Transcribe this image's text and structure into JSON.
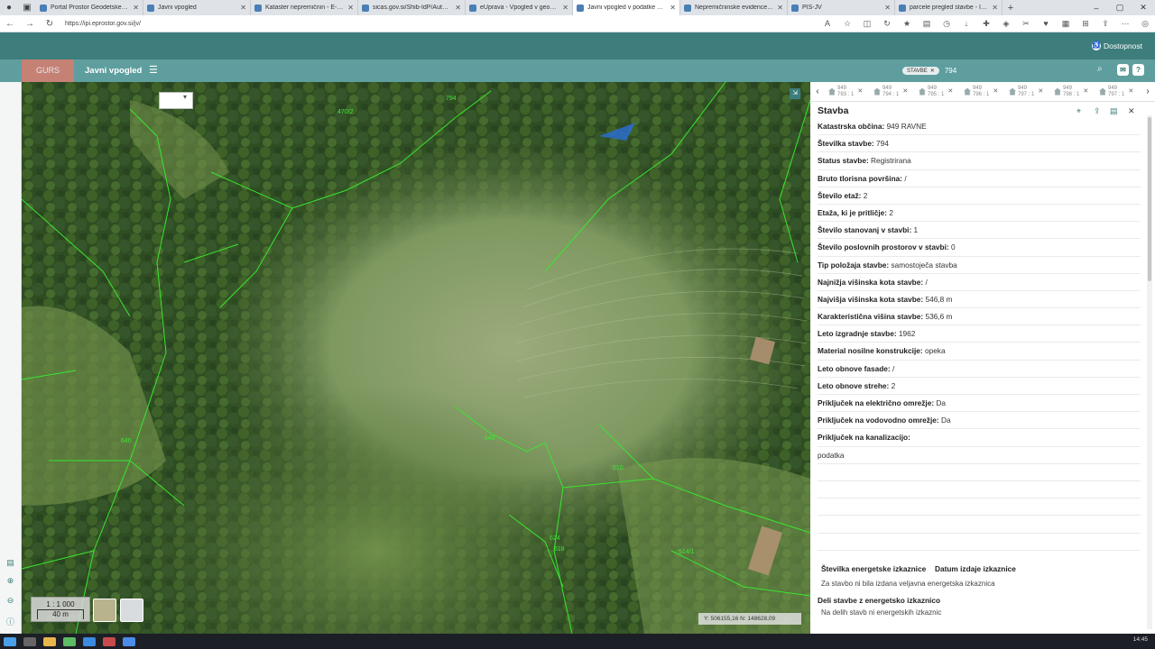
{
  "browser": {
    "tabs": [
      {
        "title": "Portal Prostor Geodetske uprave",
        "active": false
      },
      {
        "title": "Javni vpogled",
        "active": false
      },
      {
        "title": "Kataster nepremičnin - E-prostor",
        "active": false
      },
      {
        "title": "sicas.gov.si/Shib-IdP/Authn/SICAS",
        "active": false
      },
      {
        "title": "eUprava - Vpogled v geodetske p",
        "active": false
      },
      {
        "title": "Javni vpogled v podatke o nepre",
        "active": true
      },
      {
        "title": "Nepremičninske evidence | GOV.SI",
        "active": false
      },
      {
        "title": "PIS-JV",
        "active": false
      },
      {
        "title": "parcele pregled stavbe - Iskanje",
        "active": false
      }
    ],
    "url": "https://ipi.eprostor.gov.si/jv/"
  },
  "app": {
    "accessibility": "Dostopnost",
    "title": "Javni vpogled",
    "search_chip": "STAVBE",
    "search_value": "794"
  },
  "map": {
    "scale_ratio": "1 : 1 000",
    "scale_bar": "40 m",
    "coords": "Y: 506155,16  N: 148628,09",
    "parcel_labels": [
      "470/2",
      "794",
      "640",
      "646",
      "610",
      "514/1",
      "618",
      "624"
    ]
  },
  "panel": {
    "title": "Stavba",
    "building_tabs": [
      {
        "top": "949",
        "bottom": "793 : 1"
      },
      {
        "top": "949",
        "bottom": "794 : 1"
      },
      {
        "top": "949",
        "bottom": "795 : 1"
      },
      {
        "top": "949",
        "bottom": "796 : 1"
      },
      {
        "top": "949",
        "bottom": "797 : 1"
      },
      {
        "top": "949",
        "bottom": "798 : 1"
      },
      {
        "top": "949",
        "bottom": "797 : 1"
      }
    ],
    "rows": [
      {
        "label": "Katastrska občina:",
        "value": "949 RAVNE"
      },
      {
        "label": "Številka stavbe:",
        "value": "794"
      },
      {
        "label": "Status stavbe:",
        "value": "Registrirana"
      },
      {
        "label": "Bruto tlorisna površina:",
        "value": "/"
      },
      {
        "label": "Število etaž:",
        "value": "2"
      },
      {
        "label": "Etaža, ki je pritličje:",
        "value": "2"
      },
      {
        "label": "Število stanovanj v stavbi:",
        "value": "1"
      },
      {
        "label": "Število poslovnih prostorov v stavbi:",
        "value": "0"
      },
      {
        "label": "Tip položaja stavbe:",
        "value": "samostoječa stavba"
      },
      {
        "label": "Najnižja višinska kota stavbe:",
        "value": "/"
      },
      {
        "label": "Najvišja višinska kota stavbe:",
        "value": "546,8 m"
      },
      {
        "label": "Karakteristična višina stavbe:",
        "value": "536,6 m"
      },
      {
        "label": "Leto izgradnje stavbe:",
        "value": "1962"
      },
      {
        "label": "Material nosilne konstrukcije:",
        "value": "opeka"
      },
      {
        "label": "Leto obnove fasade:",
        "value": "/"
      },
      {
        "label": "Leto obnove strehe:",
        "value": "2"
      },
      {
        "label": "Priključek na električno omrežje:",
        "value": "Da"
      },
      {
        "label": "Priključek na vodovodno omrežje:",
        "value": "Da"
      },
      {
        "label": "Priključek na kanalizacijo:",
        "value": ""
      },
      {
        "label": "",
        "value": "podatka"
      },
      {
        "label": "",
        "value": ""
      },
      {
        "label": "",
        "value": ""
      },
      {
        "label": "",
        "value": ""
      },
      {
        "label": "",
        "value": ""
      },
      {
        "label": "",
        "value": ""
      }
    ],
    "energy_header": [
      "Številka energetske izkaznice",
      "Datum izdaje izkaznice"
    ],
    "energy_text": "Za stavbo ni bila izdana veljavna energetska izkaznica",
    "deli_title": "Deli stavbe z energetsko izkaznico",
    "deli_text": "Na delih stavb ni energetskih izkaznic"
  },
  "taskbar": {
    "clock": "14:45"
  }
}
